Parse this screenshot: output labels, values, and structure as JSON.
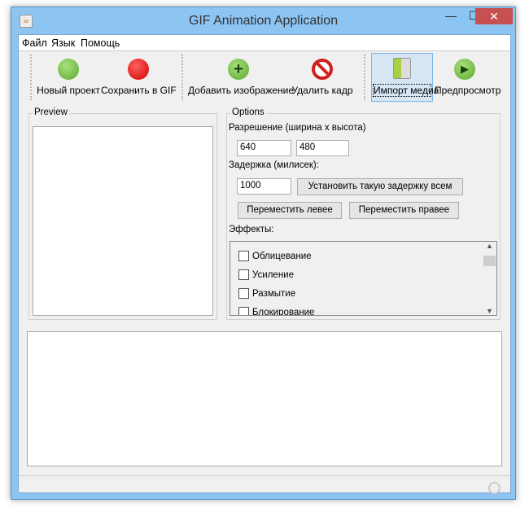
{
  "window": {
    "title": "GIF Animation Application",
    "min": "—",
    "max": "☐",
    "close": "✕"
  },
  "menu": [
    "Файл",
    "Язык",
    "Помощь"
  ],
  "toolbar": [
    {
      "label": "Новый проект",
      "icon": "green-circle-icon",
      "color": "#6cbb3c"
    },
    {
      "label": "Сохранить в GIF",
      "icon": "red-circle-icon",
      "color": "#e01010"
    },
    {
      "label": "Добавить изображение",
      "icon": "add-icon",
      "color": "#6cbb3c"
    },
    {
      "label": "Удалить кадр",
      "icon": "no-entry-icon",
      "color": "#d02020"
    },
    {
      "label": "Импорт медиа",
      "icon": "import-media-icon",
      "color": "#a8d040"
    },
    {
      "label": "Предпросмотр",
      "icon": "play-icon",
      "color": "#6cbb3c"
    }
  ],
  "preview": {
    "title": "Preview"
  },
  "options": {
    "title": "Options",
    "resolution_label": "Разрешение (ширина x высота)",
    "width": "640",
    "height": "480",
    "delay_label": "Задержка (милисек):",
    "delay": "1000",
    "set_delay_all": "Установить такую задержку всем",
    "move_left": "Переместить левее",
    "move_right": "Переместить правее",
    "effects_label": "Эффекты:",
    "effects": [
      "Облицевание",
      "Усиление",
      "Размытие",
      "Блокирование"
    ]
  }
}
